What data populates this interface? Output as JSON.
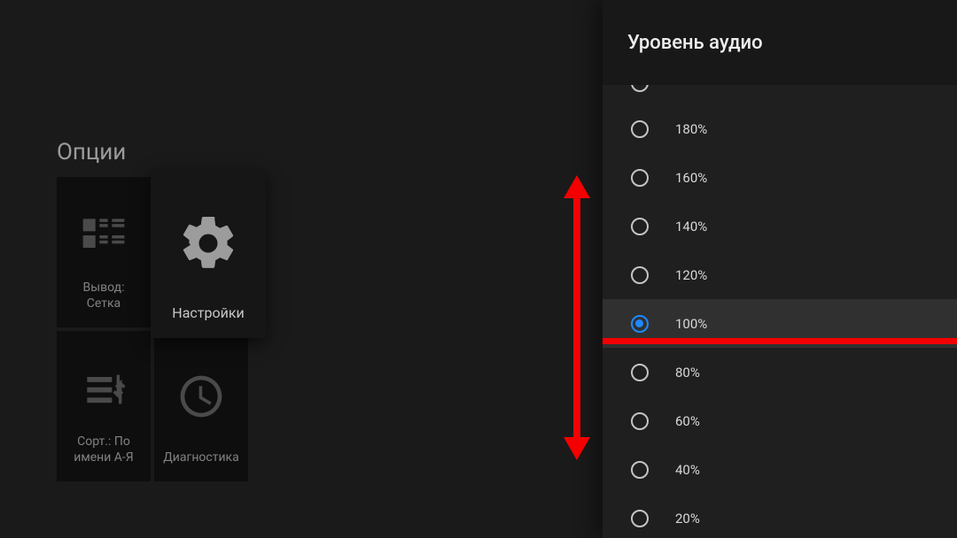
{
  "sidebar": {
    "title": "Опции",
    "tiles": [
      {
        "label": "Вывод:\nСетка"
      },
      {
        "label": "Настройки"
      },
      {
        "label": "Сорт.: По\nимени А-Я"
      },
      {
        "label": "Диагностика"
      }
    ]
  },
  "panel": {
    "title": "Уровень аудио",
    "options": [
      {
        "label": "180%",
        "selected": false
      },
      {
        "label": "160%",
        "selected": false
      },
      {
        "label": "140%",
        "selected": false
      },
      {
        "label": "120%",
        "selected": false
      },
      {
        "label": "100%",
        "selected": true
      },
      {
        "label": "80%",
        "selected": false
      },
      {
        "label": "60%",
        "selected": false
      },
      {
        "label": "40%",
        "selected": false
      },
      {
        "label": "20%",
        "selected": false
      }
    ]
  }
}
